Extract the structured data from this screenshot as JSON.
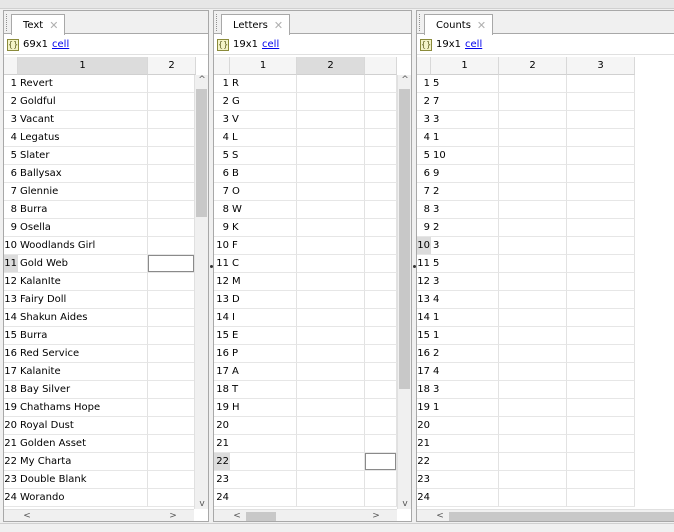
{
  "panels": [
    {
      "id": "text",
      "tab_label": "Text",
      "size_label": "69x1",
      "class_link": "cell",
      "columns": [
        "1",
        "2"
      ],
      "selected_column": 1,
      "selected_row": 11,
      "rows": [
        {
          "n": "1",
          "v": "Revert"
        },
        {
          "n": "2",
          "v": "Goldful"
        },
        {
          "n": "3",
          "v": "Vacant"
        },
        {
          "n": "4",
          "v": "Legatus"
        },
        {
          "n": "5",
          "v": "Slater"
        },
        {
          "n": "6",
          "v": "Ballysax"
        },
        {
          "n": "7",
          "v": "Glennie"
        },
        {
          "n": "8",
          "v": "Burra"
        },
        {
          "n": "9",
          "v": "Osella"
        },
        {
          "n": "10",
          "v": "Woodlands Girl"
        },
        {
          "n": "11",
          "v": "Gold Web"
        },
        {
          "n": "12",
          "v": "KalanIte"
        },
        {
          "n": "13",
          "v": "Fairy Doll"
        },
        {
          "n": "14",
          "v": "Shakun Aides"
        },
        {
          "n": "15",
          "v": "Burra"
        },
        {
          "n": "16",
          "v": "Red Service"
        },
        {
          "n": "17",
          "v": "Kalanite"
        },
        {
          "n": "18",
          "v": "Bay Silver"
        },
        {
          "n": "19",
          "v": "Chathams Hope"
        },
        {
          "n": "20",
          "v": "Royal Dust"
        },
        {
          "n": "21",
          "v": "Golden Asset"
        },
        {
          "n": "22",
          "v": "My Charta"
        },
        {
          "n": "23",
          "v": "Double Blank"
        },
        {
          "n": "24",
          "v": "Worando"
        }
      ]
    },
    {
      "id": "letters",
      "tab_label": "Letters",
      "size_label": "19x1",
      "class_link": "cell",
      "columns": [
        "1",
        "2",
        ""
      ],
      "selected_column": 2,
      "selected_row": 22,
      "rows": [
        {
          "n": "1",
          "v": "R"
        },
        {
          "n": "2",
          "v": "G"
        },
        {
          "n": "3",
          "v": "V"
        },
        {
          "n": "4",
          "v": "L"
        },
        {
          "n": "5",
          "v": "S"
        },
        {
          "n": "6",
          "v": "B"
        },
        {
          "n": "7",
          "v": "O"
        },
        {
          "n": "8",
          "v": "W"
        },
        {
          "n": "9",
          "v": "K"
        },
        {
          "n": "10",
          "v": "F"
        },
        {
          "n": "11",
          "v": "C"
        },
        {
          "n": "12",
          "v": "M"
        },
        {
          "n": "13",
          "v": "D"
        },
        {
          "n": "14",
          "v": "I"
        },
        {
          "n": "15",
          "v": "E"
        },
        {
          "n": "16",
          "v": "P"
        },
        {
          "n": "17",
          "v": "A"
        },
        {
          "n": "18",
          "v": "T"
        },
        {
          "n": "19",
          "v": "H"
        },
        {
          "n": "20",
          "v": ""
        },
        {
          "n": "21",
          "v": ""
        },
        {
          "n": "22",
          "v": ""
        },
        {
          "n": "23",
          "v": ""
        },
        {
          "n": "24",
          "v": ""
        }
      ]
    },
    {
      "id": "counts",
      "tab_label": "Counts",
      "size_label": "19x1",
      "class_link": "cell",
      "columns": [
        "1",
        "2",
        "3"
      ],
      "selected_column": -1,
      "selected_row": 10,
      "rows": [
        {
          "n": "1",
          "v": "5"
        },
        {
          "n": "2",
          "v": "7"
        },
        {
          "n": "3",
          "v": "3"
        },
        {
          "n": "4",
          "v": "1"
        },
        {
          "n": "5",
          "v": "10"
        },
        {
          "n": "6",
          "v": "9"
        },
        {
          "n": "7",
          "v": "2"
        },
        {
          "n": "8",
          "v": "3"
        },
        {
          "n": "9",
          "v": "2"
        },
        {
          "n": "10",
          "v": "3"
        },
        {
          "n": "11",
          "v": "5"
        },
        {
          "n": "12",
          "v": "3"
        },
        {
          "n": "13",
          "v": "4"
        },
        {
          "n": "14",
          "v": "1"
        },
        {
          "n": "15",
          "v": "1"
        },
        {
          "n": "16",
          "v": "2"
        },
        {
          "n": "17",
          "v": "4"
        },
        {
          "n": "18",
          "v": "3"
        },
        {
          "n": "19",
          "v": "1"
        },
        {
          "n": "20",
          "v": ""
        },
        {
          "n": "21",
          "v": ""
        },
        {
          "n": "22",
          "v": ""
        },
        {
          "n": "23",
          "v": ""
        },
        {
          "n": "24",
          "v": ""
        }
      ]
    }
  ],
  "icons": {
    "close": "close-icon",
    "variable": "variable-icon",
    "scroll_up": "chevron-up-icon",
    "scroll_down": "chevron-down-icon",
    "scroll_left": "chevron-left-icon",
    "scroll_right": "chevron-right-icon"
  }
}
